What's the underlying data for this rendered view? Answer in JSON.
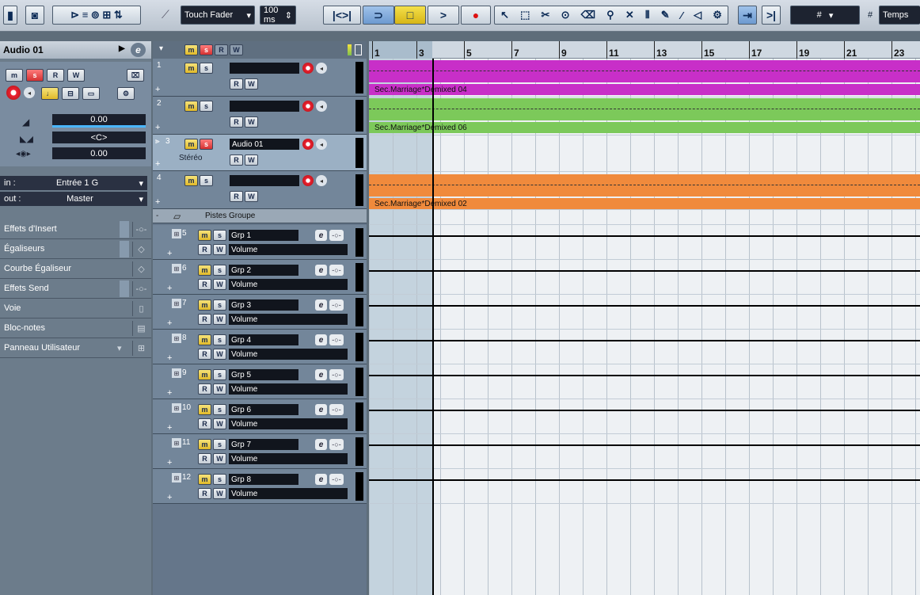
{
  "toolbar": {
    "automation_mode": "Touch Fader",
    "automation_time": "100 ms",
    "grid_label": "Temps",
    "snap_value": "#"
  },
  "inspector": {
    "title": "Audio 01",
    "volume": "0.00",
    "pan": "<C>",
    "delay": "0.00",
    "in_label": "in :",
    "in_value": "Entrée 1 G",
    "out_label": "out :",
    "out_value": "Master",
    "sections": [
      "Effets d'Insert",
      "Égaliseurs",
      "Courbe Égaliseur",
      "Effets Send",
      "Voie",
      "Bloc-notes",
      "Panneau Utilisateur"
    ]
  },
  "tracklist_header": {
    "buttons": [
      "m",
      "s",
      "R",
      "W"
    ]
  },
  "tracks": [
    {
      "num": "1",
      "name": "",
      "sub": ""
    },
    {
      "num": "2",
      "name": "",
      "sub": ""
    },
    {
      "num": "3",
      "name": "Audio 01",
      "sub": "Stéréo"
    },
    {
      "num": "4",
      "name": "",
      "sub": ""
    }
  ],
  "folder": {
    "name": "Pistes Groupe"
  },
  "groups": [
    {
      "num": "5",
      "name": "Grp 1",
      "param": "Volume"
    },
    {
      "num": "6",
      "name": "Grp 2",
      "param": "Volume"
    },
    {
      "num": "7",
      "name": "Grp 3",
      "param": "Volume"
    },
    {
      "num": "8",
      "name": "Grp 4",
      "param": "Volume"
    },
    {
      "num": "9",
      "name": "Grp 5",
      "param": "Volume"
    },
    {
      "num": "10",
      "name": "Grp 6",
      "param": "Volume"
    },
    {
      "num": "11",
      "name": "Grp 7",
      "param": "Volume"
    },
    {
      "num": "12",
      "name": "Grp 8",
      "param": "Volume"
    }
  ],
  "ruler": {
    "bars": [
      "1",
      "3",
      "5",
      "7",
      "9",
      "11",
      "13",
      "15",
      "17",
      "19",
      "21",
      "23"
    ]
  },
  "parts": [
    {
      "label": "Sec.Marriage*Demixed 04",
      "color": "#c82fc8"
    },
    {
      "label": "Sec.Marriage*Demixed 06",
      "color": "#7cc95a"
    },
    {
      "label": "Sec.Marriage*Demixed 02",
      "color": "#f08a3c"
    }
  ]
}
